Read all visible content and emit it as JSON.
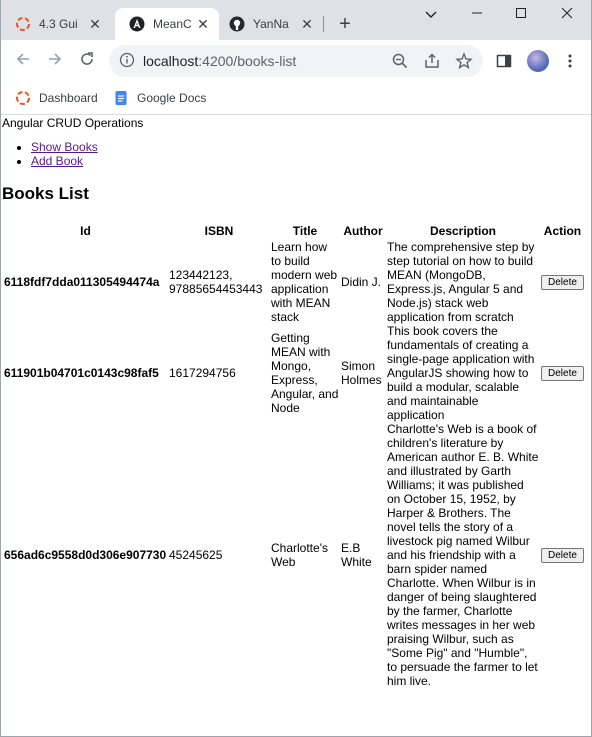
{
  "browser": {
    "tabs": [
      {
        "title": "4.3 Gui",
        "icon": "ubuntu-icon"
      },
      {
        "title": "MeanC",
        "icon": "angular-icon"
      },
      {
        "title": "YanNa",
        "icon": "github-icon"
      }
    ],
    "url_host": "localhost",
    "url_path": ":4200/books-list",
    "bookmarks": [
      {
        "label": "Dashboard",
        "icon": "ubuntu-icon"
      },
      {
        "label": "Google Docs",
        "icon": "docs-icon"
      }
    ],
    "colors": {
      "tabstrip": "#dee1e6",
      "omnibox": "#f1f3f4",
      "link": "#551a8b"
    }
  },
  "page": {
    "app_title": "Angular CRUD Operations",
    "nav": [
      "Show Books",
      "Add Book"
    ],
    "heading": "Books List",
    "columns": [
      "Id",
      "ISBN",
      "Title",
      "Author",
      "Description",
      "Action"
    ],
    "rows": [
      {
        "id": "6118fdf7dda011305494474a",
        "isbn": "123442123, 97885654453443",
        "title": "Learn how to build modern web application with MEAN stack",
        "author": "Didin J.",
        "description": "The comprehensive step by step tutorial on how to build MEAN (MongoDB, Express.js, Angular 5 and Node.js) stack web application from scratch",
        "action": "Delete"
      },
      {
        "id": "611901b04701c0143c98faf5",
        "isbn": "1617294756",
        "title": "Getting MEAN with Mongo, Express, Angular, and Node",
        "author": "Simon Holmes",
        "description": "This book covers the fundamentals of creating a single-page application with AngularJS showing how to build a modular, scalable and maintainable application",
        "action": "Delete"
      },
      {
        "id": "656ad6c9558d0d306e907730",
        "isbn": "45245625",
        "title": "Charlotte's Web",
        "author": "E.B White",
        "description": "Charlotte's Web is a book of children's literature by American author E. B. White and illustrated by Garth Williams; it was published on October 15, 1952, by Harper & Brothers. The novel tells the story of a livestock pig named Wilbur and his friendship with a barn spider named Charlotte. When Wilbur is in danger of being slaughtered by the farmer, Charlotte writes messages in her web praising Wilbur, such as \"Some Pig\" and \"Humble\", to persuade the farmer to let him live.",
        "action": "Delete"
      }
    ]
  }
}
